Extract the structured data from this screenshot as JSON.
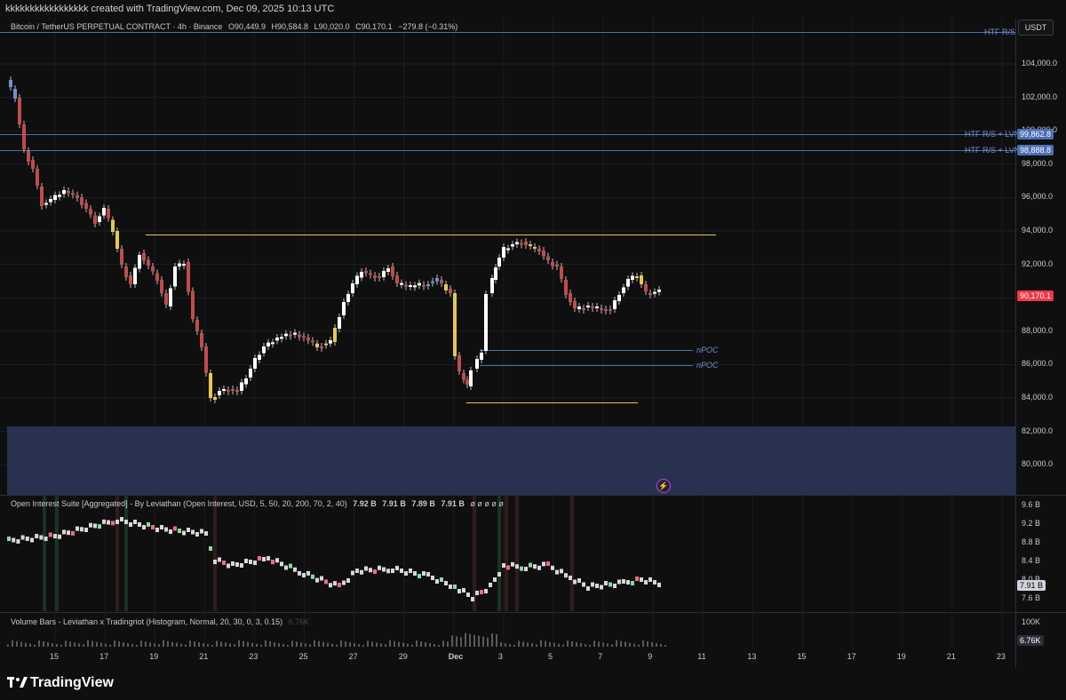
{
  "header": {
    "creator_line": "kkkkkkkkkkkkkkkkk created with TradingView.com, Dec 09, 2025 10:13 UTC"
  },
  "symbol_bar": {
    "symbol": "Bitcoin / TetherUS PERPETUAL CONTRACT · 4h · Binance",
    "open": "O90,449.9",
    "high": "H90,584.8",
    "low": "L90,020.0",
    "close": "C90,170.1",
    "change": "−279.8 (−0.31%)",
    "currency": "USDT"
  },
  "price_axis": {
    "ticks": [
      "104,000.0",
      "102,000.0",
      "100,000.0",
      "98,000.0",
      "96,000.0",
      "94,000.0",
      "92,000.0",
      "90,000.0",
      "88,000.0",
      "86,000.0",
      "84,000.0",
      "82,000.0",
      "80,000.0"
    ],
    "last_price": "90,170.1",
    "level_tags": [
      "99,862.8",
      "98,888.8"
    ]
  },
  "annotations": {
    "htf_top": "HTF R/S",
    "htf_lvn_1": "HTF R/S + LVN",
    "htf_lvn_2": "HTF R/S + LVN",
    "npoc_1": "nPOC",
    "npoc_2": "nPOC"
  },
  "oi_indicator": {
    "title": "Open Interest Suite [Aggregated] - By Leviathan (Open Interest, USD, 5, 50, 20, 200, 70, 2, 40)",
    "values": [
      "7.92 B",
      "7.91 B",
      "7.89 B",
      "7.91 B"
    ],
    "empties": "ø ø ø ø ø",
    "ticks": [
      "9.6 B",
      "9.2 B",
      "8.8 B",
      "8.4 B",
      "8.0 B",
      "7.6 B"
    ],
    "last": "7.91 B"
  },
  "volume_indicator": {
    "title": "Volume Bars - Leviathan x Tradingriot  (Histogram, Normal, 20, 30, 0, 3, 0.15)",
    "inline_value": "6.76K",
    "ticks": [
      "100K"
    ],
    "last": "6.76K"
  },
  "time_axis": {
    "labels": [
      "15",
      "17",
      "19",
      "21",
      "23",
      "25",
      "27",
      "29",
      "Dec",
      "3",
      "5",
      "7",
      "9",
      "11",
      "13",
      "15",
      "17",
      "19",
      "21",
      "23"
    ]
  },
  "footer": {
    "brand": "TradingView"
  },
  "colors": {
    "background": "#0f0f0f",
    "bull": "#ffffff",
    "bear": "#c24b4b",
    "accent_blue": "#4a6fb5",
    "yellow_line": "#e6c84a",
    "last_price_tag": "#f23645",
    "zone_fill": "#2a3454"
  }
}
